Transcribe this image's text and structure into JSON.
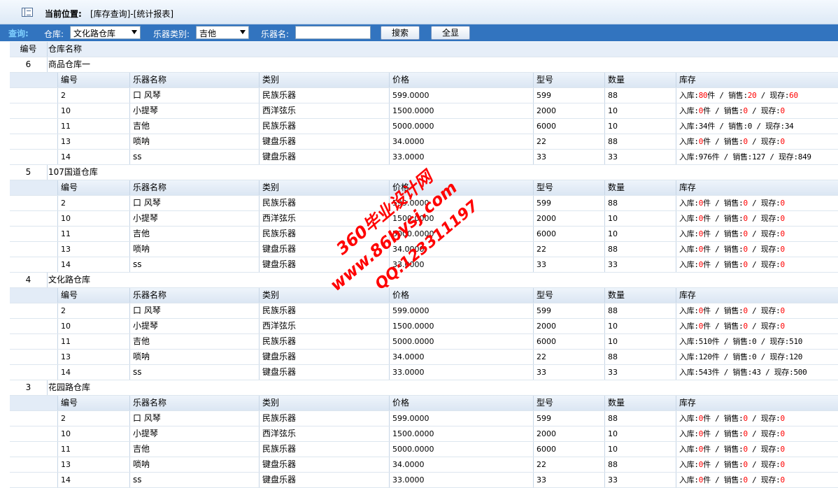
{
  "header": {
    "location_label": "当前位置:",
    "location_value": "[库存查询]-[统计报表]"
  },
  "search": {
    "query_label": "查询:",
    "warehouse_label": "仓库:",
    "warehouse_value": "文化路仓库",
    "category_label": "乐器类别:",
    "category_value": "吉他",
    "name_label": "乐器名:",
    "name_value": "",
    "search_button": "搜索",
    "show_all_button": "全显"
  },
  "outer_columns": [
    "编号",
    "仓库名称"
  ],
  "inner_columns": [
    "编号",
    "乐器名称",
    "类别",
    "价格",
    "型号",
    "数量",
    "库存"
  ],
  "stock_labels": {
    "in": "入库:",
    "sales": "销售:",
    "current": "现存:",
    "unit": "件"
  },
  "warehouses": [
    {
      "id": "6",
      "name": "商品仓库一",
      "items": [
        {
          "id": "2",
          "name": "口 风琴",
          "category": "民族乐器",
          "price": "599.0000",
          "model": "599",
          "qty": "88",
          "in": "80",
          "sales": "20",
          "current": "60",
          "in_unit": true,
          "red": true
        },
        {
          "id": "10",
          "name": "小提琴",
          "category": "西洋弦乐",
          "price": "1500.0000",
          "model": "2000",
          "qty": "10",
          "in": "0",
          "sales": "0",
          "current": "0",
          "in_unit": true,
          "red": true
        },
        {
          "id": "11",
          "name": "吉他",
          "category": "民族乐器",
          "price": "5000.0000",
          "model": "6000",
          "qty": "10",
          "in": "34",
          "sales": "0",
          "current": "34",
          "in_unit": true,
          "red": false
        },
        {
          "id": "13",
          "name": "唢呐",
          "category": "键盘乐器",
          "price": "34.0000",
          "model": "22",
          "qty": "88",
          "in": "0",
          "sales": "0",
          "current": "0",
          "in_unit": true,
          "red": true
        },
        {
          "id": "14",
          "name": "ss",
          "category": "键盘乐器",
          "price": "33.0000",
          "model": "33",
          "qty": "33",
          "in": "976",
          "sales": "127",
          "current": "849",
          "in_unit": true,
          "red": false
        }
      ]
    },
    {
      "id": "5",
      "name": "107国道仓库",
      "items": [
        {
          "id": "2",
          "name": "口 风琴",
          "category": "民族乐器",
          "price": "599.0000",
          "model": "599",
          "qty": "88",
          "in": "0",
          "sales": "0",
          "current": "0",
          "in_unit": true,
          "red": true
        },
        {
          "id": "10",
          "name": "小提琴",
          "category": "西洋弦乐",
          "price": "1500.0000",
          "model": "2000",
          "qty": "10",
          "in": "0",
          "sales": "0",
          "current": "0",
          "in_unit": true,
          "red": true
        },
        {
          "id": "11",
          "name": "吉他",
          "category": "民族乐器",
          "price": "5000.0000",
          "model": "6000",
          "qty": "10",
          "in": "0",
          "sales": "0",
          "current": "0",
          "in_unit": true,
          "red": true
        },
        {
          "id": "13",
          "name": "唢呐",
          "category": "键盘乐器",
          "price": "34.0000",
          "model": "22",
          "qty": "88",
          "in": "0",
          "sales": "0",
          "current": "0",
          "in_unit": true,
          "red": true
        },
        {
          "id": "14",
          "name": "ss",
          "category": "键盘乐器",
          "price": "33.0000",
          "model": "33",
          "qty": "33",
          "in": "0",
          "sales": "0",
          "current": "0",
          "in_unit": true,
          "red": true
        }
      ]
    },
    {
      "id": "4",
      "name": "文化路仓库",
      "items": [
        {
          "id": "2",
          "name": "口 风琴",
          "category": "民族乐器",
          "price": "599.0000",
          "model": "599",
          "qty": "88",
          "in": "0",
          "sales": "0",
          "current": "0",
          "in_unit": true,
          "red": true
        },
        {
          "id": "10",
          "name": "小提琴",
          "category": "西洋弦乐",
          "price": "1500.0000",
          "model": "2000",
          "qty": "10",
          "in": "0",
          "sales": "0",
          "current": "0",
          "in_unit": true,
          "red": true
        },
        {
          "id": "11",
          "name": "吉他",
          "category": "民族乐器",
          "price": "5000.0000",
          "model": "6000",
          "qty": "10",
          "in": "510",
          "sales": "0",
          "current": "510",
          "in_unit": true,
          "red": false
        },
        {
          "id": "13",
          "name": "唢呐",
          "category": "键盘乐器",
          "price": "34.0000",
          "model": "22",
          "qty": "88",
          "in": "120",
          "sales": "0",
          "current": "120",
          "in_unit": true,
          "red": false
        },
        {
          "id": "14",
          "name": "ss",
          "category": "键盘乐器",
          "price": "33.0000",
          "model": "33",
          "qty": "33",
          "in": "543",
          "sales": "43",
          "current": "500",
          "in_unit": true,
          "red": false
        }
      ]
    },
    {
      "id": "3",
      "name": "花园路仓库",
      "items": [
        {
          "id": "2",
          "name": "口 风琴",
          "category": "民族乐器",
          "price": "599.0000",
          "model": "599",
          "qty": "88",
          "in": "0",
          "sales": "0",
          "current": "0",
          "in_unit": true,
          "red": true
        },
        {
          "id": "10",
          "name": "小提琴",
          "category": "西洋弦乐",
          "price": "1500.0000",
          "model": "2000",
          "qty": "10",
          "in": "0",
          "sales": "0",
          "current": "0",
          "in_unit": true,
          "red": true
        },
        {
          "id": "11",
          "name": "吉他",
          "category": "民族乐器",
          "price": "5000.0000",
          "model": "6000",
          "qty": "10",
          "in": "0",
          "sales": "0",
          "current": "0",
          "in_unit": true,
          "red": true
        },
        {
          "id": "13",
          "name": "唢呐",
          "category": "键盘乐器",
          "price": "34.0000",
          "model": "22",
          "qty": "88",
          "in": "0",
          "sales": "0",
          "current": "0",
          "in_unit": true,
          "red": true
        },
        {
          "id": "14",
          "name": "ss",
          "category": "键盘乐器",
          "price": "33.0000",
          "model": "33",
          "qty": "33",
          "in": "0",
          "sales": "0",
          "current": "0",
          "in_unit": true,
          "red": true
        }
      ]
    }
  ],
  "watermark": {
    "line1": "360毕业设计网",
    "line2": "www.86bysj.com",
    "line3": "QQ:123311197"
  },
  "colors": {
    "search_bar": "#3274bf",
    "header_bg": "#e6eef8",
    "highlight_red": "#ff0000"
  }
}
